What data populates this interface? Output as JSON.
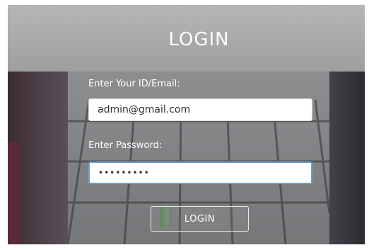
{
  "banner": {
    "title": "LOGIN"
  },
  "form": {
    "email_label": "Enter Your ID/Email:",
    "email_value": "admin@gmail.com",
    "password_label": "Enter Password:",
    "password_value": "•••••••••",
    "login_button": "LOGIN"
  },
  "colors": {
    "banner_bg": "#aeadb0",
    "field_focus_border": "#6a9fd4",
    "text_white": "#ffffff"
  }
}
